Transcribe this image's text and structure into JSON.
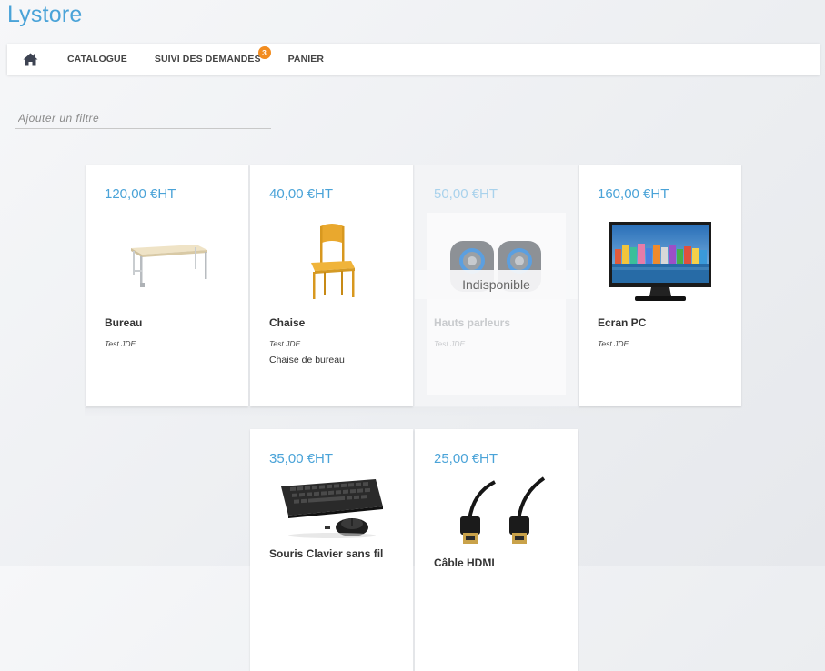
{
  "app": {
    "title": "Lystore"
  },
  "nav": {
    "home_icon": "home-icon",
    "items": [
      {
        "label": "CATALOGUE"
      },
      {
        "label": "SUIVI DES DEMANDES",
        "badge": "3"
      },
      {
        "label": "PANIER"
      }
    ]
  },
  "filter": {
    "placeholder": "Ajouter un filtre",
    "value": ""
  },
  "products": [
    {
      "price": "120,00 €HT",
      "name": "Bureau",
      "owner": "Test JDE",
      "description": "",
      "available": true,
      "image": "desk-image"
    },
    {
      "price": "40,00 €HT",
      "name": "Chaise",
      "owner": "Test JDE",
      "description": "Chaise de bureau",
      "available": true,
      "image": "chair-image"
    },
    {
      "price": "50,00 €HT",
      "name": "Hauts parleurs",
      "owner": "Test JDE",
      "description": "",
      "available": false,
      "status": "Indisponible",
      "image": "speakers-image"
    },
    {
      "price": "160,00 €HT",
      "name": "Ecran PC",
      "owner": "Test JDE",
      "description": "",
      "available": true,
      "image": "monitor-image"
    },
    {
      "price": "35,00 €HT",
      "name": "Souris Clavier sans fil",
      "owner": "",
      "description": "",
      "available": true,
      "image": "keyboard-mouse-image"
    },
    {
      "price": "25,00 €HT",
      "name": "Câble HDMI",
      "owner": "",
      "description": "",
      "available": true,
      "image": "hdmi-cable-image"
    }
  ],
  "colors": {
    "accent": "#4aa3d8",
    "badge": "#f28c1f"
  }
}
